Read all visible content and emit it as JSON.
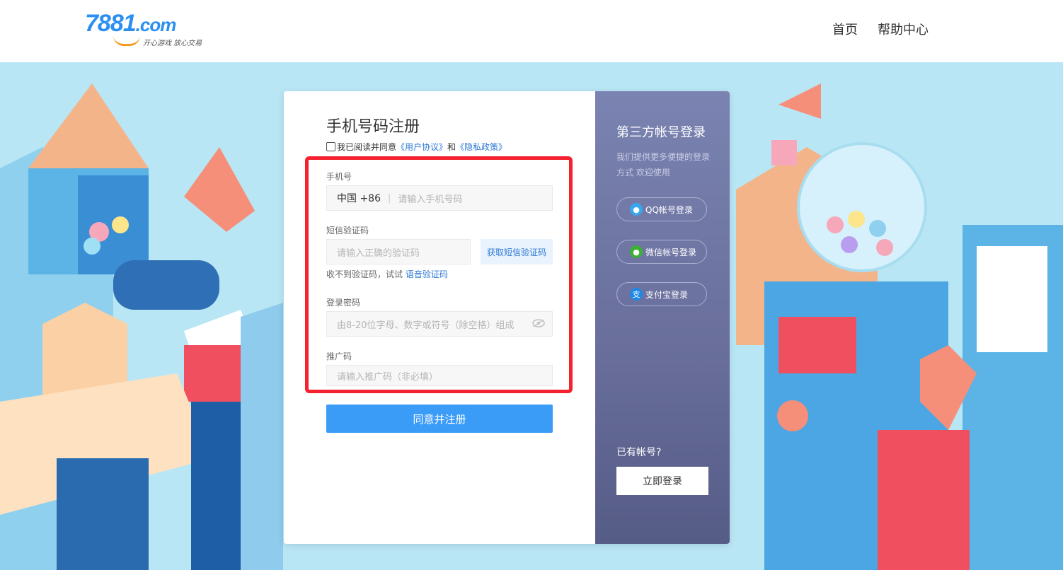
{
  "header": {
    "logo_text": "7881",
    "logo_suffix": ".com",
    "logo_slogan": "开心游戏 放心交易",
    "nav": [
      "首页",
      "帮助中心"
    ]
  },
  "register": {
    "title": "手机号码注册",
    "agree_prefix": "我已阅读并同意",
    "user_agreement": "《用户协议》",
    "and": "和",
    "privacy_policy": "《隐私政策》",
    "phone_label": "手机号",
    "country": "中国 +86",
    "phone_placeholder": "请输入手机号码",
    "sms_label": "短信验证码",
    "sms_placeholder": "请输入正确的验证码",
    "sms_button": "获取短信验证码",
    "hint_text": "收不到验证码，试试",
    "voice_code": "语音验证码",
    "password_label": "登录密码",
    "password_placeholder": "由8-20位字母、数字或符号（除空格）组成",
    "promo_label": "推广码",
    "promo_placeholder": "请输入推广码（非必填）",
    "submit": "同意并注册"
  },
  "third_party": {
    "title": "第三方帐号登录",
    "desc": "我们提供更多便捷的登录方式 欢迎使用",
    "qq": "QQ帐号登录",
    "wechat": "微信帐号登录",
    "alipay": "支付宝登录",
    "have_account": "已有帐号?",
    "login_now": "立即登录"
  },
  "colors": {
    "accent": "#3b9cf8",
    "highlight": "#f6212f",
    "panel": "#6a6f9c"
  }
}
